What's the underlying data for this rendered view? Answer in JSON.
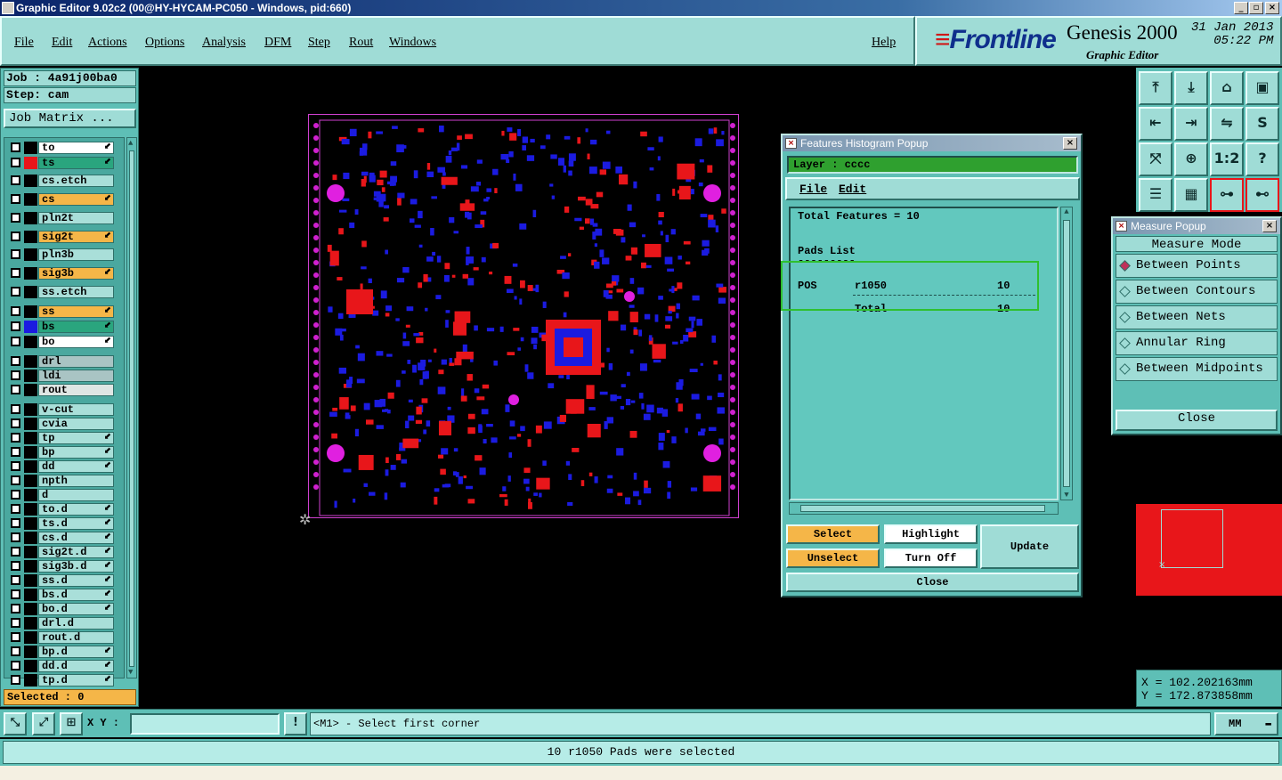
{
  "window": {
    "title": "Graphic Editor 9.02c2 (00@HY-HYCAM-PC050 - Windows, pid:660)"
  },
  "menu": {
    "items": [
      "File",
      "Edit",
      "Actions",
      "Options",
      "Analysis",
      "DFM",
      "Step",
      "Rout",
      "Windows"
    ],
    "help": "Help"
  },
  "brand": {
    "logo": "Frontline",
    "product": "Genesis 2000",
    "module": "Graphic Editor",
    "date": "31 Jan 2013",
    "time": "05:22 PM"
  },
  "job": {
    "job_line": "Job : 4a91j00ba0",
    "step_line": "Step: cam",
    "matrix_button": "Job Matrix ..."
  },
  "layers": [
    {
      "name": "to",
      "bg": "#ffffff",
      "swatch": "#000000",
      "arrow": true
    },
    {
      "name": "ts",
      "bg": "#2aa57e",
      "swatch": "#e8161a",
      "arrow": true
    },
    {
      "name": "cs.etch",
      "bg": "#a9dfd9",
      "swatch": "#000000",
      "arrow": false
    },
    {
      "name": "cs",
      "bg": "#f5b648",
      "swatch": "#000000",
      "arrow": true
    },
    {
      "name": "pln2t",
      "bg": "#a9dfd9",
      "swatch": "#000000",
      "arrow": false
    },
    {
      "name": "sig2t",
      "bg": "#f5b648",
      "swatch": "#000000",
      "arrow": true
    },
    {
      "name": "pln3b",
      "bg": "#a9dfd9",
      "swatch": "#000000",
      "arrow": false
    },
    {
      "name": "sig3b",
      "bg": "#f5b648",
      "swatch": "#000000",
      "arrow": true
    },
    {
      "name": "ss.etch",
      "bg": "#a9dfd9",
      "swatch": "#000000",
      "arrow": false
    },
    {
      "name": "ss",
      "bg": "#f5b648",
      "swatch": "#000000",
      "arrow": true
    },
    {
      "name": "bs",
      "bg": "#2aa57e",
      "swatch": "#1b1be0",
      "arrow": true
    },
    {
      "name": "bo",
      "bg": "#ffffff",
      "swatch": "#000000",
      "arrow": true
    },
    {
      "name": "drl",
      "bg": "#a9c4c4",
      "swatch": "#000000",
      "arrow": false
    },
    {
      "name": "ldi",
      "bg": "#a9c4c4",
      "swatch": "#000000",
      "arrow": false
    },
    {
      "name": "rout",
      "bg": "#dfe6e4",
      "swatch": "#000000",
      "arrow": false
    },
    {
      "name": "v-cut",
      "bg": "#a9dfd9",
      "swatch": "#000000",
      "arrow": false
    },
    {
      "name": "cvia",
      "bg": "#a9dfd9",
      "swatch": "#000000",
      "arrow": false
    },
    {
      "name": "tp",
      "bg": "#a9dfd9",
      "swatch": "#000000",
      "arrow": true
    },
    {
      "name": "bp",
      "bg": "#a9dfd9",
      "swatch": "#000000",
      "arrow": true
    },
    {
      "name": "dd",
      "bg": "#a9dfd9",
      "swatch": "#000000",
      "arrow": true
    },
    {
      "name": "npth",
      "bg": "#a9dfd9",
      "swatch": "#000000",
      "arrow": false
    },
    {
      "name": "d",
      "bg": "#a9dfd9",
      "swatch": "#000000",
      "arrow": false
    },
    {
      "name": "to.d",
      "bg": "#a9dfd9",
      "swatch": "#000000",
      "arrow": true
    },
    {
      "name": "ts.d",
      "bg": "#a9dfd9",
      "swatch": "#000000",
      "arrow": true
    },
    {
      "name": "cs.d",
      "bg": "#a9dfd9",
      "swatch": "#000000",
      "arrow": true
    },
    {
      "name": "sig2t.d",
      "bg": "#a9dfd9",
      "swatch": "#000000",
      "arrow": true
    },
    {
      "name": "sig3b.d",
      "bg": "#a9dfd9",
      "swatch": "#000000",
      "arrow": true
    },
    {
      "name": "ss.d",
      "bg": "#a9dfd9",
      "swatch": "#000000",
      "arrow": true
    },
    {
      "name": "bs.d",
      "bg": "#a9dfd9",
      "swatch": "#000000",
      "arrow": true
    },
    {
      "name": "bo.d",
      "bg": "#a9dfd9",
      "swatch": "#000000",
      "arrow": true
    },
    {
      "name": "drl.d",
      "bg": "#a9dfd9",
      "swatch": "#000000",
      "arrow": false
    },
    {
      "name": "rout.d",
      "bg": "#a9dfd9",
      "swatch": "#000000",
      "arrow": false
    },
    {
      "name": "bp.d",
      "bg": "#a9dfd9",
      "swatch": "#000000",
      "arrow": true
    },
    {
      "name": "dd.d",
      "bg": "#a9dfd9",
      "swatch": "#000000",
      "arrow": true
    },
    {
      "name": "tp.d",
      "bg": "#a9dfd9",
      "swatch": "#000000",
      "arrow": true
    }
  ],
  "selected": "Selected : 0",
  "histogram": {
    "title": "Features Histogram Popup",
    "layer_label": "Layer :  cccc",
    "menu": [
      "File",
      "Edit"
    ],
    "total_features": "Total Features = 10",
    "pads_list": "Pads List",
    "dashes": "---------",
    "row_pol": "POS",
    "row_sym": "r1050",
    "row_count": "10",
    "total_label": "Total",
    "total_count": "10",
    "buttons": {
      "select": "Select",
      "highlight": "Highlight",
      "update": "Update",
      "unselect": "Unselect",
      "turn_off": "Turn Off",
      "close": "Close"
    }
  },
  "measure": {
    "title": "Measure Popup",
    "mode_label": "Measure Mode",
    "options": [
      "Between Points",
      "Between Contours",
      "Between Nets",
      "Annular Ring",
      "Between Midpoints"
    ],
    "selected_index": 0,
    "close": "Close"
  },
  "tools": [
    "home-up-icon",
    "home-down-icon",
    "house-icon",
    "panel-icon",
    "arrow-left-icon",
    "arrow-right-icon",
    "flip-icon",
    "mirror-icon",
    "fit-icon",
    "center-icon",
    "one-to-one-icon",
    "help-icon",
    "settings-icon",
    "grid-icon",
    "snap-icon",
    "layers-icon"
  ],
  "tool_glyphs": [
    "⤒",
    "⤓",
    "⌂",
    "▣",
    "⇤",
    "⇥",
    "⇋",
    "S",
    "⤧",
    "⊕",
    "1:2",
    "?",
    "☰",
    "▦",
    "⊶",
    "⊷"
  ],
  "coords": {
    "x": "X = 102.202163mm",
    "y": "Y = 172.873858mm"
  },
  "bottom": {
    "xy_label": "X Y :",
    "xy_value": "",
    "prompt": "<M1> - Select first corner",
    "units": "MM"
  },
  "status": "10 r1050 Pads were selected",
  "colors": {
    "bg": "#000000",
    "panel": "#5ebfb6",
    "accent": "#f5b648",
    "highlight": "#2fc02f",
    "board_top": "#e8161a",
    "board_bottom": "#1b1be0",
    "outline": "#d040d0"
  }
}
